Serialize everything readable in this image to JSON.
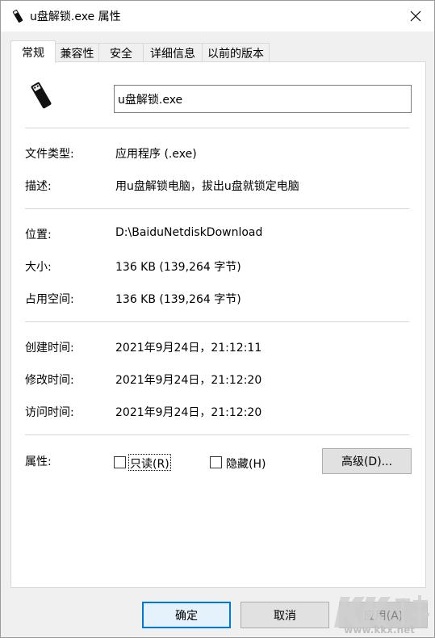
{
  "window": {
    "title": "u盘解锁.exe 属性",
    "close_label": "✕"
  },
  "tabs": [
    {
      "label": "常规",
      "active": true
    },
    {
      "label": "兼容性"
    },
    {
      "label": "安全"
    },
    {
      "label": "详细信息"
    },
    {
      "label": "以前的版本"
    }
  ],
  "general": {
    "file_name": "u盘解锁.exe",
    "file_type_label": "文件类型:",
    "file_type_value": "应用程序 (.exe)",
    "description_label": "描述:",
    "description_value": "用u盘解锁电脑，拔出u盘就锁定电脑",
    "location_label": "位置:",
    "location_value": "D:\\BaiduNetdiskDownload",
    "size_label": "大小:",
    "size_value": "136 KB (139,264 字节)",
    "size_on_disk_label": "占用空间:",
    "size_on_disk_value": "136 KB (139,264 字节)",
    "created_label": "创建时间:",
    "created_value": "2021年9月24日，21:12:11",
    "modified_label": "修改时间:",
    "modified_value": "2021年9月24日，21:12:20",
    "accessed_label": "访问时间:",
    "accessed_value": "2021年9月24日，21:12:20",
    "attributes_label": "属性:",
    "readonly_label": "只读(R)",
    "readonly_checked": false,
    "hidden_label": "隐藏(H)",
    "hidden_checked": false,
    "advanced_label": "高级(D)..."
  },
  "footer": {
    "ok_label": "确定",
    "cancel_label": "取消",
    "apply_label": "应用(A)"
  },
  "watermark": {
    "text": "www.kkx.net"
  }
}
